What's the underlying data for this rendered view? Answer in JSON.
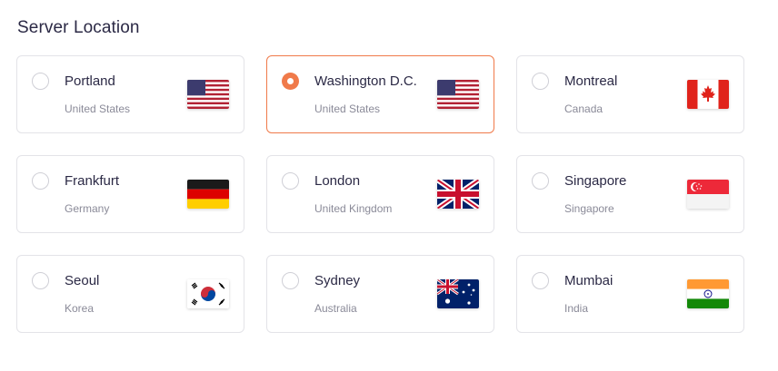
{
  "section": {
    "title": "Server Location"
  },
  "colors": {
    "accent": "#f07a4a",
    "text_primary": "#2b2945",
    "text_secondary": "#8a8a98",
    "border": "#e3e3e8"
  },
  "locations": [
    {
      "city": "Portland",
      "country": "United States",
      "flag_icon": "us-flag-icon",
      "selected": false
    },
    {
      "city": "Washington D.C.",
      "country": "United States",
      "flag_icon": "us-flag-icon",
      "selected": true
    },
    {
      "city": "Montreal",
      "country": "Canada",
      "flag_icon": "canada-flag-icon",
      "selected": false
    },
    {
      "city": "Frankfurt",
      "country": "Germany",
      "flag_icon": "germany-flag-icon",
      "selected": false
    },
    {
      "city": "London",
      "country": "United Kingdom",
      "flag_icon": "uk-flag-icon",
      "selected": false
    },
    {
      "city": "Singapore",
      "country": "Singapore",
      "flag_icon": "singapore-flag-icon",
      "selected": false
    },
    {
      "city": "Seoul",
      "country": "Korea",
      "flag_icon": "korea-flag-icon",
      "selected": false
    },
    {
      "city": "Sydney",
      "country": "Australia",
      "flag_icon": "australia-flag-icon",
      "selected": false
    },
    {
      "city": "Mumbai",
      "country": "India",
      "flag_icon": "india-flag-icon",
      "selected": false
    }
  ]
}
